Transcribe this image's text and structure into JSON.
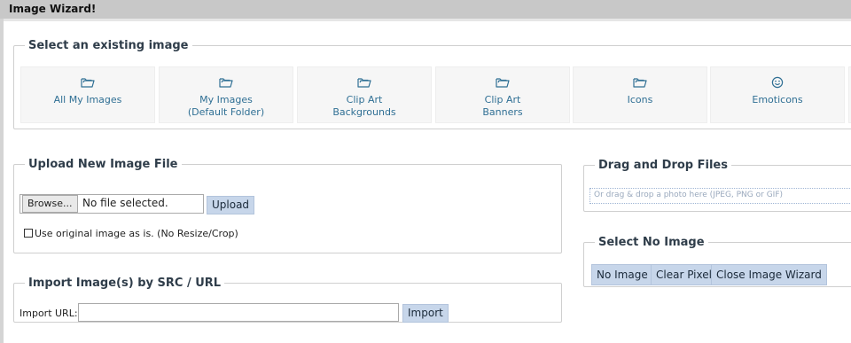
{
  "window": {
    "title": "Image Wizard!"
  },
  "existing": {
    "legend": "Select an existing image",
    "tiles": [
      {
        "icon": "folder-icon",
        "line1": "All My Images",
        "line2": ""
      },
      {
        "icon": "folder-icon",
        "line1": "My Images",
        "line2": "(Default Folder)"
      },
      {
        "icon": "folder-icon",
        "line1": "Clip Art",
        "line2": "Backgrounds"
      },
      {
        "icon": "folder-icon",
        "line1": "Clip Art",
        "line2": "Banners"
      },
      {
        "icon": "folder-icon",
        "line1": "Icons",
        "line2": ""
      },
      {
        "icon": "smiley-icon",
        "line1": "Emoticons",
        "line2": ""
      }
    ]
  },
  "upload": {
    "legend": "Upload New Image File",
    "browse_label": "Browse...",
    "file_status": "No file selected.",
    "upload_label": "Upload",
    "checkbox_label": "Use original image as is. (No Resize/Crop)"
  },
  "import": {
    "legend": "Import Image(s) by SRC / URL",
    "url_label": "Import URL:",
    "url_value": "",
    "import_label": "Import"
  },
  "dragdrop": {
    "legend": "Drag and Drop Files",
    "placeholder": "Or drag & drop a photo here (JPEG, PNG or GIF)"
  },
  "noimage": {
    "legend": "Select No Image",
    "buttons": [
      "No Image",
      "Clear Pixel",
      "Close Image Wizard"
    ]
  },
  "colors": {
    "accent": "#2f6f94",
    "button_bg": "#c7d6ea",
    "titlebar": "#c8c8c8"
  }
}
